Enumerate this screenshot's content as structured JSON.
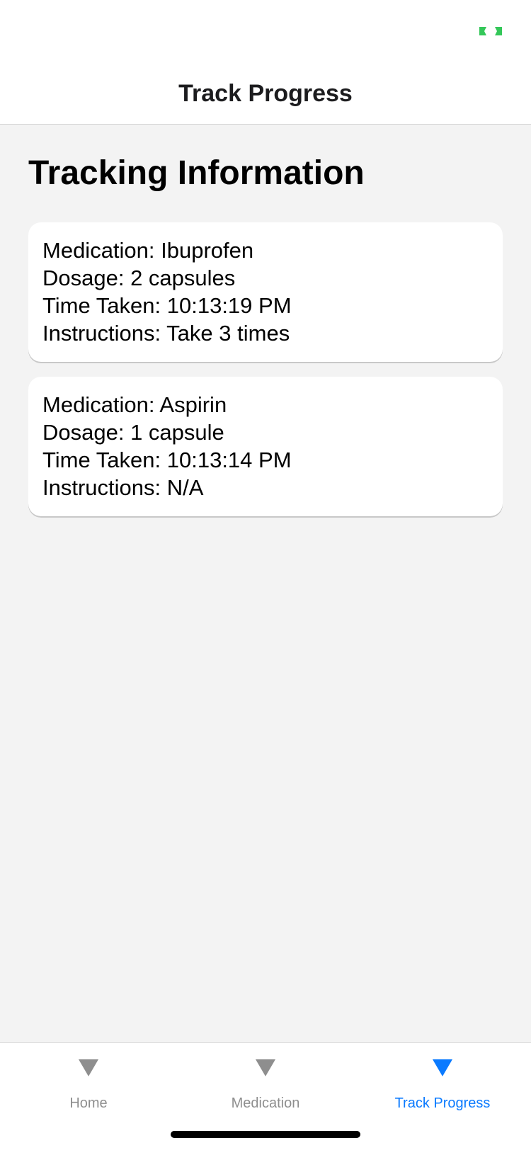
{
  "colors": {
    "background": "#f3f3f3",
    "card": "#ffffff",
    "active_tab": "#0a7aff",
    "inactive_tab": "#8e8e8e",
    "status_indicator": "#34c759"
  },
  "status_bar": {
    "indicator_icon": "green-brackets-icon"
  },
  "nav": {
    "title": "Track Progress"
  },
  "main": {
    "section_title": "Tracking Information",
    "entries": [
      {
        "medication": "Medication: Ibuprofen",
        "dosage": "Dosage: 2 capsules",
        "time_taken": "Time Taken: 10:13:19 PM",
        "instructions": "Instructions: Take 3 times"
      },
      {
        "medication": "Medication: Aspirin",
        "dosage": "Dosage: 1 capsule",
        "time_taken": "Time Taken: 10:13:14 PM",
        "instructions": "Instructions: N/A"
      }
    ]
  },
  "tab_bar": {
    "tabs": [
      {
        "label": "Home",
        "icon": "triangle-down-icon",
        "active": false
      },
      {
        "label": "Medication",
        "icon": "triangle-down-icon",
        "active": false
      },
      {
        "label": "Track Progress",
        "icon": "triangle-down-icon",
        "active": true
      }
    ]
  }
}
